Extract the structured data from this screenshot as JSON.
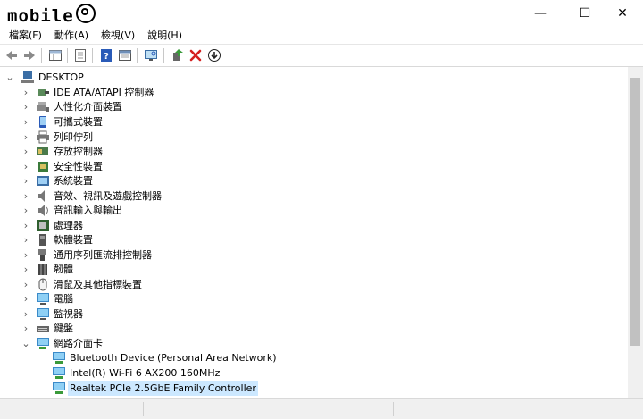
{
  "window": {
    "logo_text": "mobile",
    "minimize": "—",
    "maximize": "☐",
    "close": "✕"
  },
  "menu": [
    "檔案(F)",
    "動作(A)",
    "檢視(V)",
    "說明(H)"
  ],
  "toolbar": {
    "icons": [
      "back-icon",
      "forward-icon",
      "properties-grid-icon",
      "properties-page-icon",
      "help-icon",
      "view-console-icon",
      "monitor-scan-icon",
      "update-driver-icon",
      "uninstall-icon",
      "download-icon"
    ],
    "accent_colors": {
      "uninstall": "#d42020",
      "update_driver": "#3a9a3a",
      "help": "#2a5bb8"
    }
  },
  "tree": {
    "root": "DESKTOP",
    "categories": [
      {
        "label": "IDE ATA/ATAPI 控制器",
        "icon": "ide-controller-icon"
      },
      {
        "label": "人性化介面裝置",
        "icon": "hid-icon"
      },
      {
        "label": "可攜式裝置",
        "icon": "portable-device-icon"
      },
      {
        "label": "列印佇列",
        "icon": "printer-icon"
      },
      {
        "label": "存放控制器",
        "icon": "storage-controller-icon"
      },
      {
        "label": "安全性裝置",
        "icon": "security-device-icon"
      },
      {
        "label": "系統裝置",
        "icon": "system-device-icon"
      },
      {
        "label": "音效、視訊及遊戲控制器",
        "icon": "sound-icon"
      },
      {
        "label": "音訊輸入與輸出",
        "icon": "audio-io-icon"
      },
      {
        "label": "處理器",
        "icon": "processor-icon"
      },
      {
        "label": "軟體裝置",
        "icon": "software-device-icon"
      },
      {
        "label": "通用序列匯流排控制器",
        "icon": "usb-icon"
      },
      {
        "label": "韌體",
        "icon": "firmware-icon"
      },
      {
        "label": "滑鼠及其他指標裝置",
        "icon": "mouse-icon"
      },
      {
        "label": "電腦",
        "icon": "computer-icon"
      },
      {
        "label": "監視器",
        "icon": "monitor-icon"
      },
      {
        "label": "鍵盤",
        "icon": "keyboard-icon"
      },
      {
        "label": "網路介面卡",
        "icon": "network-adapter-icon",
        "expanded": true
      }
    ],
    "network_children": [
      "Bluetooth Device (Personal Area Network)",
      "Intel(R) Wi-Fi 6 AX200 160MHz",
      "Realtek PCIe 2.5GbE Family Controller"
    ],
    "selected": "Realtek PCIe 2.5GbE Family Controller"
  }
}
